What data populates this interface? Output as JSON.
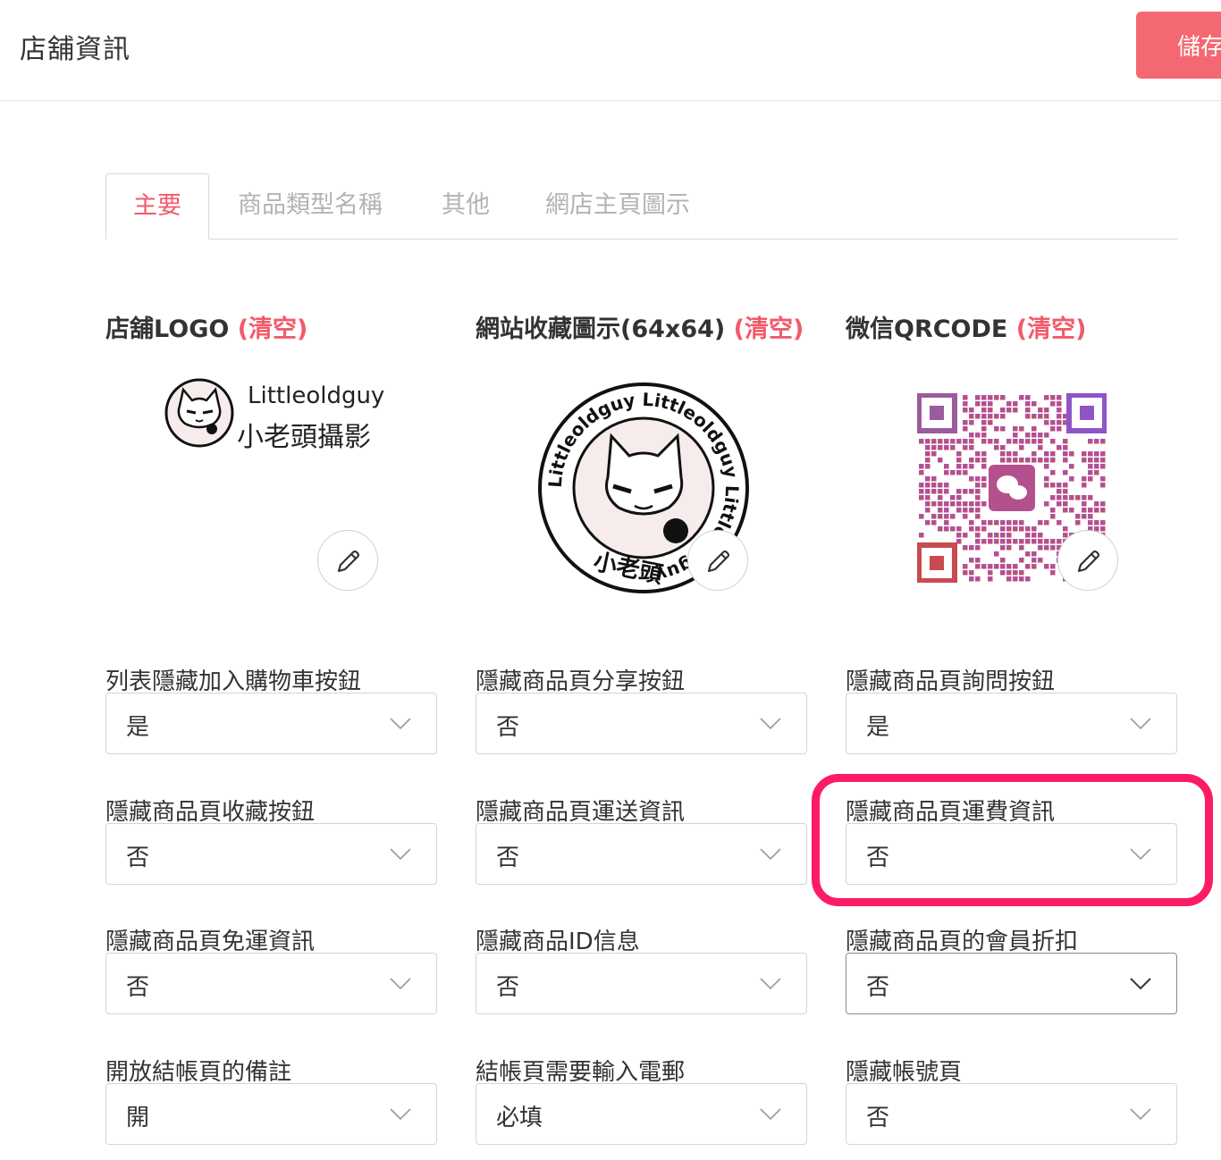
{
  "header": {
    "title": "店舖資訊",
    "save_label": "儲存"
  },
  "tabs": [
    {
      "label": "主要",
      "active": true
    },
    {
      "label": "商品類型名稱",
      "active": false
    },
    {
      "label": "其他",
      "active": false
    },
    {
      "label": "網店主頁圖示",
      "active": false
    }
  ],
  "images": {
    "clear_label": "(清空)",
    "logo": {
      "title": "店舖LOGO",
      "brand_en": "Littleoldguy",
      "brand_zh": "小老頭攝影"
    },
    "favicon": {
      "title": "網站收藏圖示(64x64)",
      "ring_text": "Littleoldguy Littleoldguy Littleoldguy",
      "bottom_text": "小老頭"
    },
    "wechat": {
      "title": "微信QRCODE"
    }
  },
  "fields": [
    {
      "label": "列表隱藏加入購物車按鈕",
      "value": "是"
    },
    {
      "label": "隱藏商品頁分享按鈕",
      "value": "否"
    },
    {
      "label": "隱藏商品頁詢問按鈕",
      "value": "是"
    },
    {
      "label": "隱藏商品頁收藏按鈕",
      "value": "否"
    },
    {
      "label": "隱藏商品頁運送資訊",
      "value": "否"
    },
    {
      "label": "隱藏商品頁運費資訊",
      "value": "否"
    },
    {
      "label": "隱藏商品頁免運資訊",
      "value": "否"
    },
    {
      "label": "隱藏商品ID信息",
      "value": "否"
    },
    {
      "label": "隱藏商品頁的會員折扣",
      "value": "否"
    },
    {
      "label": "開放結帳頁的備註",
      "value": "開"
    },
    {
      "label": "結帳頁需要輸入電郵",
      "value": "必填"
    },
    {
      "label": "隱藏帳號頁",
      "value": "否"
    }
  ],
  "colors": {
    "accent": "#f25a6a",
    "save_button": "#f46872",
    "highlight": "#fb1c63"
  },
  "icons": {
    "edit": "pencil-icon",
    "dropdown": "chevron-down-icon"
  }
}
